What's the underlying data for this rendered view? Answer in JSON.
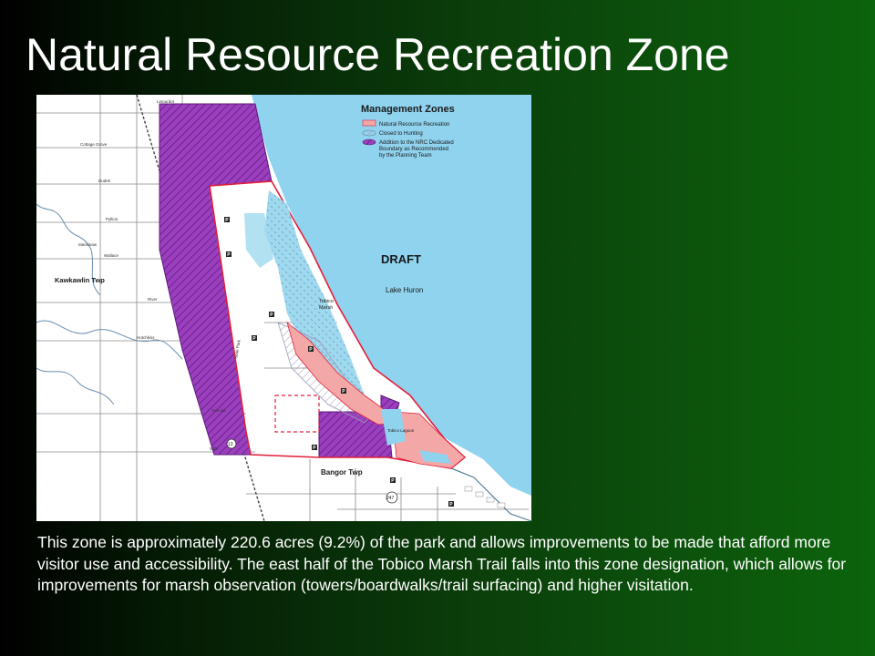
{
  "slide": {
    "title": "Natural Resource Recreation Zone",
    "description": "This zone is approximately 220.6 acres (9.2%) of the park and allows improvements to be made that afford more visitor use and accessibility.  The east half of the Tobico Marsh Trail falls into this zone designation, which allows for improvements for marsh observation (towers/boardwalks/trail surfacing) and higher visitation."
  },
  "map": {
    "legend": {
      "title": "Management Zones",
      "items": [
        {
          "label": "Natural Resource Recreation",
          "color": "#f4a7a7"
        },
        {
          "label": "Closed to Hunting",
          "color": "#9a9ab8"
        },
        {
          "label": "Addition to the NRC Dedicated",
          "color": "#9b3fbf"
        },
        {
          "label": "Boundary as Recommended",
          "color": "#9b3fbf"
        },
        {
          "label": "by the Planning Team",
          "color": "#9b3fbf"
        }
      ]
    },
    "draft_label": "DRAFT",
    "lake_label": "Lake Huron",
    "marsh_label_1": "Tobico",
    "marsh_label_2": "Marsh",
    "lagoon_label": "Tobico Lagoon",
    "township_labels": {
      "kawkawlin": "Kawkawlin Twp",
      "bangor": "Bangor Twp"
    },
    "road_labels": {
      "top": "Letourdot",
      "cottage_grove": "Cottage Grove",
      "dudek": "Dudek",
      "pyllion": "Pyllion",
      "mackinaw": "Mackinaw",
      "wallace": "Wallace",
      "river": "River",
      "hotchkiss": "Hotchkiss",
      "tuscola": "Tuscola",
      "side_road": "Side",
      "state_park": "State Park"
    },
    "route_shields": [
      "13",
      "247"
    ],
    "parking_marker": "P",
    "colors": {
      "lake": "#8fd3ef",
      "marsh": "#9fd9ef",
      "nrr": "#f4a7a7",
      "boundary": "#e0203a",
      "addition": "#9b3fbf",
      "roads": "#8a8a8a",
      "rivers": "#6a8fb0"
    }
  }
}
